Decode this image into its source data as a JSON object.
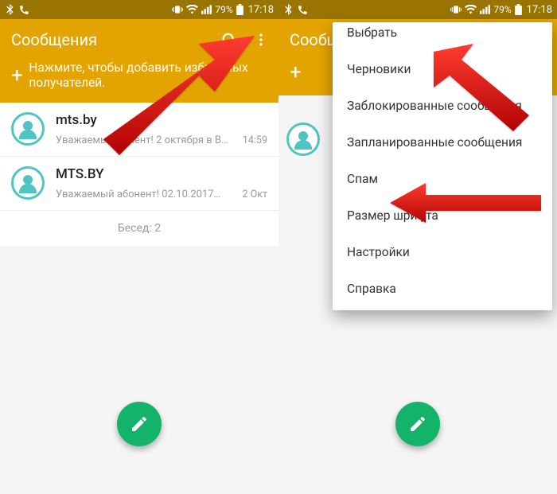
{
  "colors": {
    "accent": "#e4a400",
    "fab": "#14b36a",
    "avatar": "#4fc4c2",
    "arrow": "#d30808"
  },
  "status": {
    "battery_text": "79%",
    "time": "17:18"
  },
  "header": {
    "title": "Сообщения",
    "subtitle": "Нажмите, чтобы добавить избранных получателей.",
    "title_truncated_right": "Сообщ"
  },
  "conversations": [
    {
      "title": "mts.by",
      "snippet": "Уважаемый клиент! 2 октября в В…",
      "time": "14:59"
    },
    {
      "title": "MTS.BY",
      "snippet": "Уважаемый абонент! 02.10.2017…",
      "time": "2 Окт"
    }
  ],
  "footer": "Бесед: 2",
  "menu": {
    "items": [
      "Выбрать",
      "Черновики",
      "Заблокированные сообщения",
      "Запланированные сообщения",
      "Спам",
      "Размер шрифта",
      "Настройки",
      "Справка"
    ]
  }
}
